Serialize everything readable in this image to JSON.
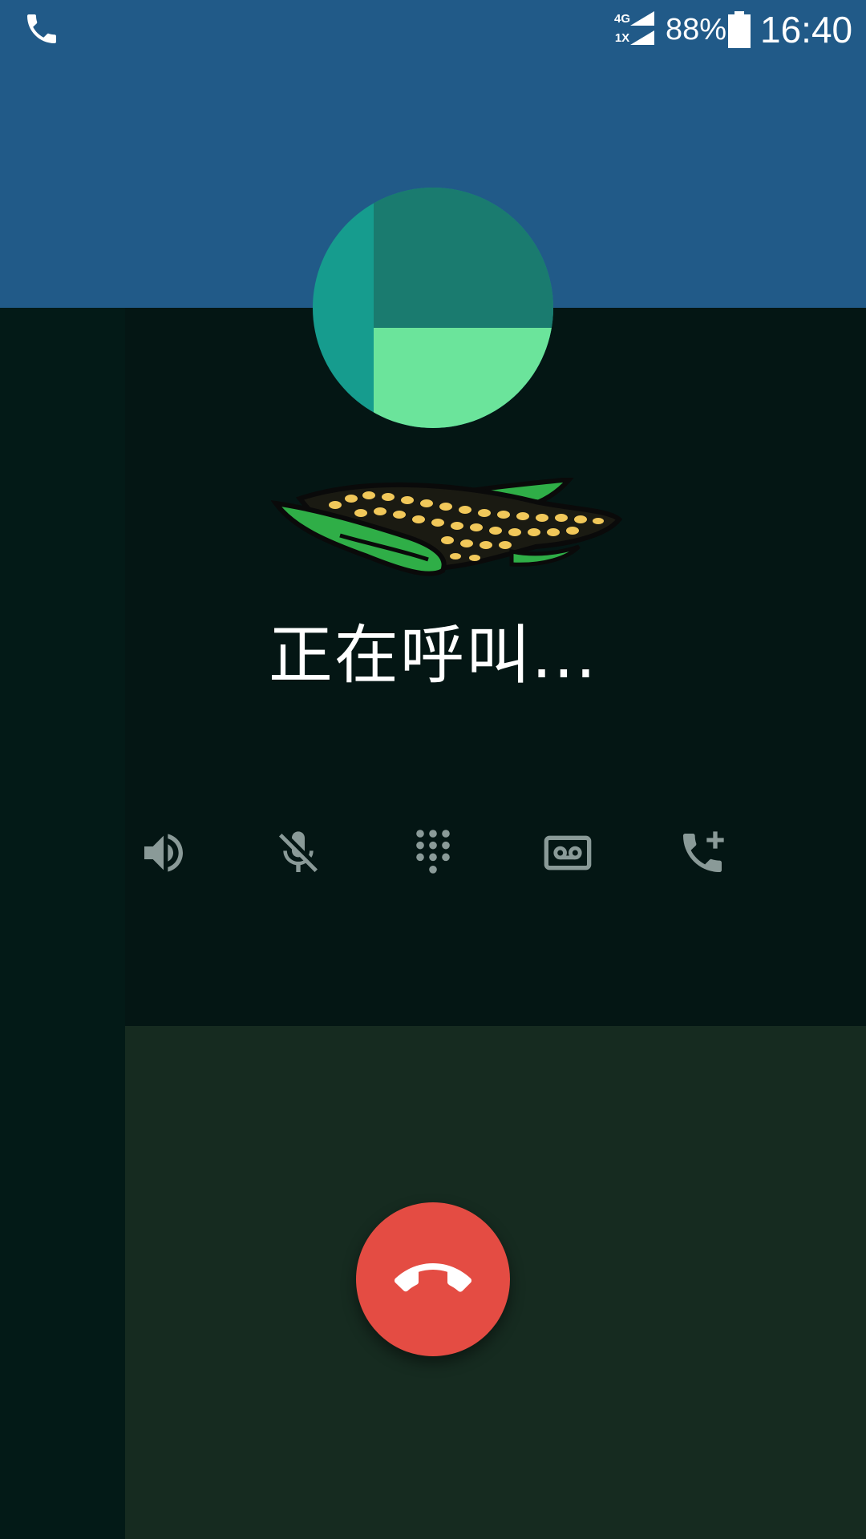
{
  "status_bar": {
    "network_top": "4G",
    "network_bottom": "1X",
    "battery": "88%",
    "battery_level": 0.88,
    "time": "16:40",
    "icons": [
      "phone-icon",
      "signal-icon",
      "battery-icon"
    ]
  },
  "call": {
    "status_text": "正在呼叫..."
  },
  "controls": [
    {
      "name": "speaker",
      "icon": "speaker-icon"
    },
    {
      "name": "mute",
      "icon": "mic-off-icon"
    },
    {
      "name": "dialpad",
      "icon": "dialpad-icon"
    },
    {
      "name": "record",
      "icon": "voicemail-icon"
    },
    {
      "name": "add-call",
      "icon": "add-call-icon"
    }
  ],
  "end_call": {
    "icon": "call-end-icon"
  },
  "colors": {
    "header_blue": "#215a88",
    "main_bg": "#041614",
    "left_strip": "#031a17",
    "bottom_bg": "#162b20",
    "end_call_red": "#e44c43",
    "icon_gray": "#8a9a98",
    "avatar_top_right": "#1a7b6f",
    "avatar_left": "#169c8e",
    "avatar_bottom_right": "#6be49b"
  }
}
